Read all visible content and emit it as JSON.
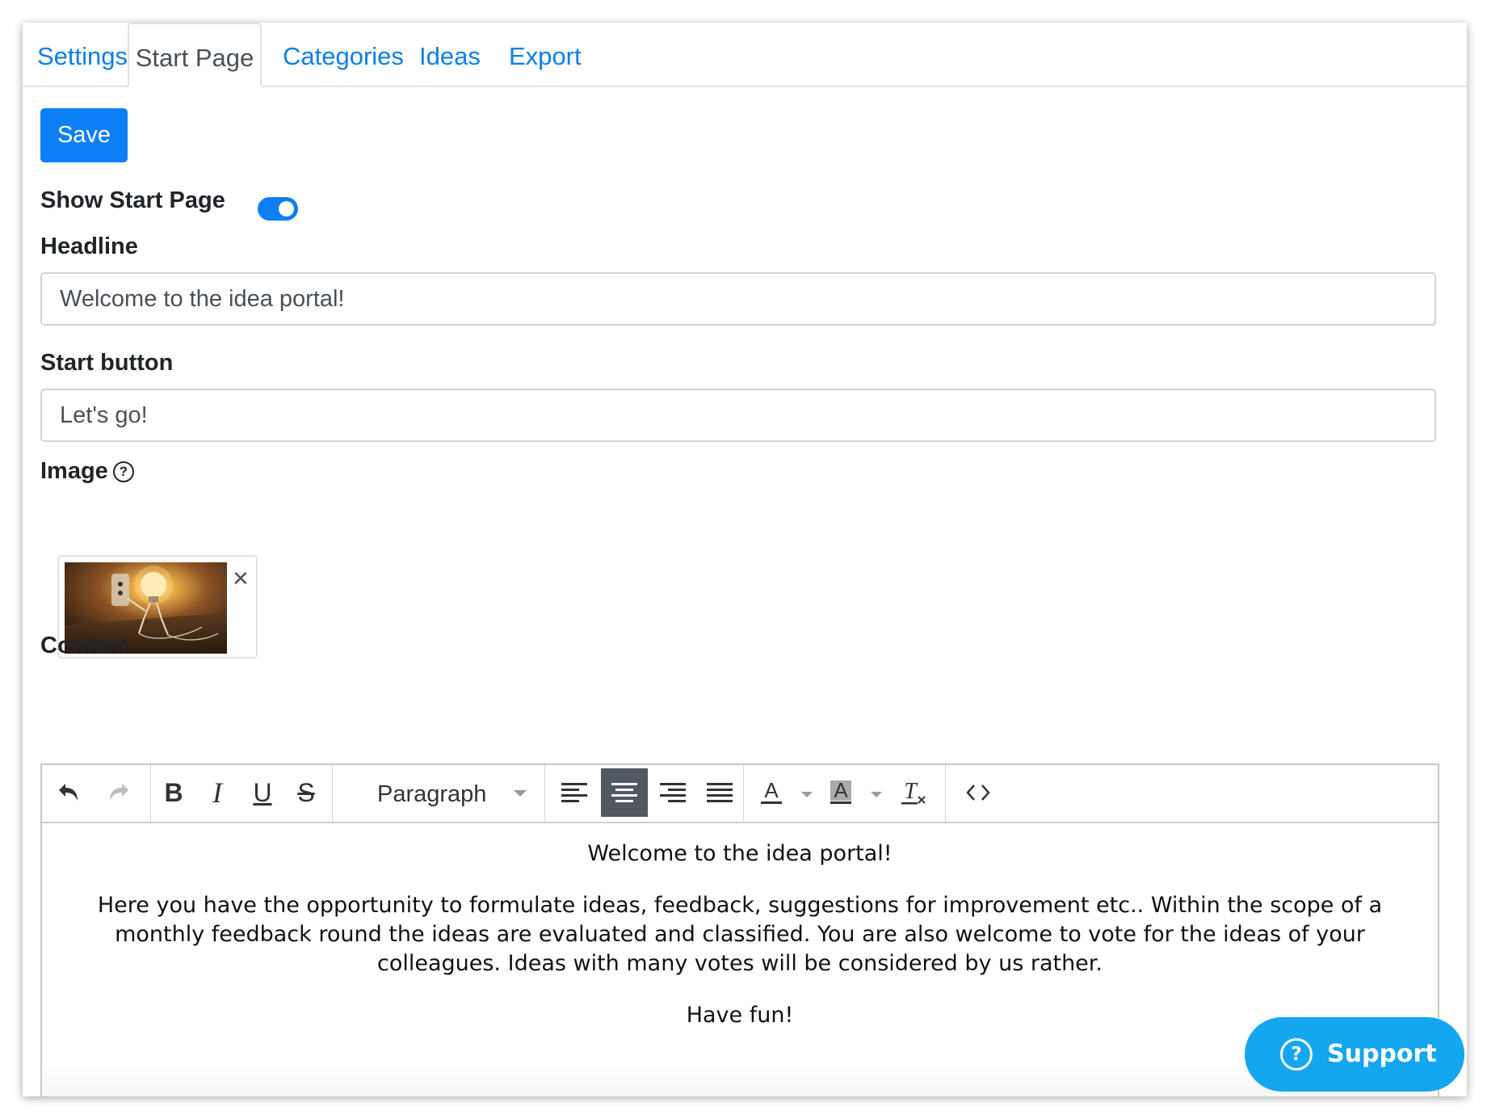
{
  "tabs": [
    {
      "label": "Settings"
    },
    {
      "label": "Start Page"
    },
    {
      "label": "Categories"
    },
    {
      "label": "Ideas"
    },
    {
      "label": "Export"
    }
  ],
  "save_label": "Save",
  "show_start_page": {
    "label": "Show Start Page",
    "enabled": true
  },
  "headline": {
    "label": "Headline",
    "value": "Welcome to the idea portal!"
  },
  "start_button": {
    "label": "Start button",
    "value": "Let's go!"
  },
  "image": {
    "label": "Image",
    "help_icon": "?",
    "remove_icon": "✕"
  },
  "content": {
    "label": "Content",
    "block_format": "Paragraph",
    "toolbar_icons": [
      "undo-icon",
      "redo-icon",
      "bold-icon",
      "italic-icon",
      "underline-icon",
      "strikethrough-icon",
      "align-left-icon",
      "align-center-icon",
      "align-right-icon",
      "align-justify-icon",
      "text-color-icon",
      "background-color-icon",
      "clear-formatting-icon",
      "source-code-icon"
    ],
    "paragraphs": [
      "Welcome to the idea portal!",
      "Here you have the opportunity to formulate ideas, feedback, suggestions for improvement etc.. Within the scope of a monthly feedback round the ideas are evaluated and classified. You are also welcome to vote for the ideas of your colleagues. Ideas with many votes will be considered by us rather.",
      "Have fun!"
    ]
  },
  "support": {
    "label": "Support",
    "icon": "?"
  },
  "colors": {
    "accent": "#0d7ff5",
    "support": "#14a6ee",
    "link": "#0d7ee8",
    "active_tool": "#4f5961"
  }
}
